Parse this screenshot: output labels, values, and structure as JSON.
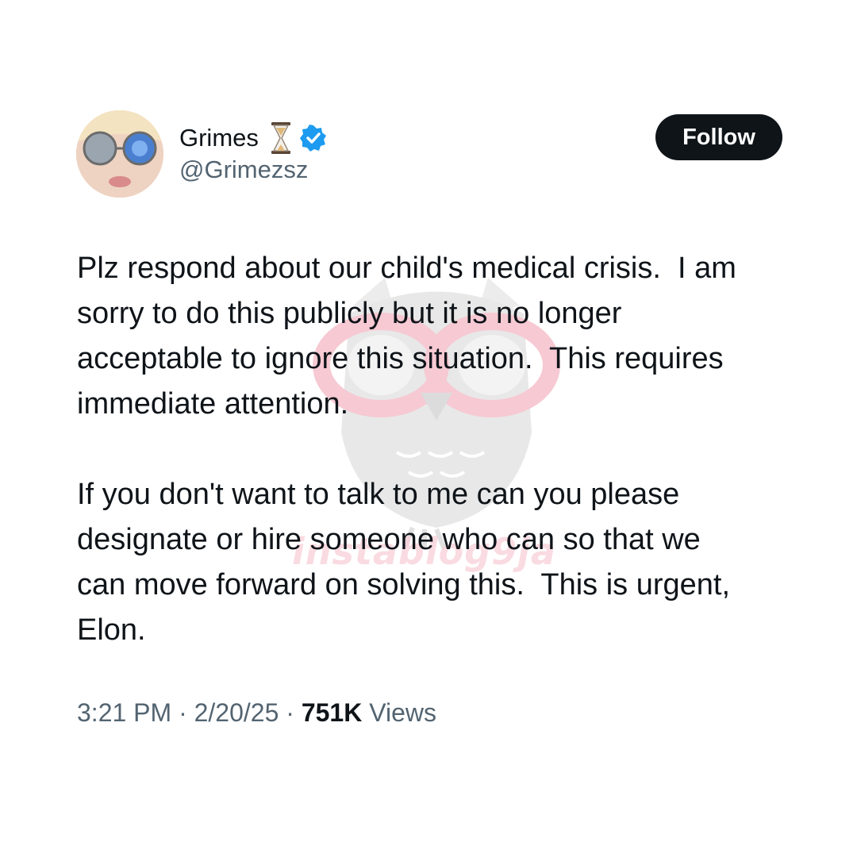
{
  "user": {
    "display_name": "Grimes",
    "handle": "@Grimezsz",
    "badge_icons": [
      "hourglass-icon",
      "verified-icon"
    ],
    "verified_color": "#1d9bf0"
  },
  "follow_button": {
    "label": "Follow",
    "background": "#0f1419"
  },
  "tweet": {
    "paragraphs": [
      "Plz respond about our child's medical crisis.  I am\nsorry to do this publicly but it is no longer\nacceptable to ignore this situation.  This requires\nimmediate attention.",
      "If you don't want to talk to me can you please\ndesignate or hire someone who can so that we\ncan move forward on solving this.  This is urgent,\nElon."
    ]
  },
  "meta": {
    "time": "3:21 PM",
    "separator": " · ",
    "date": "2/20/25",
    "views_count": "751K",
    "views_label": " Views"
  },
  "watermark": {
    "text": "instablog9ja",
    "color": "#f7cfd8"
  }
}
